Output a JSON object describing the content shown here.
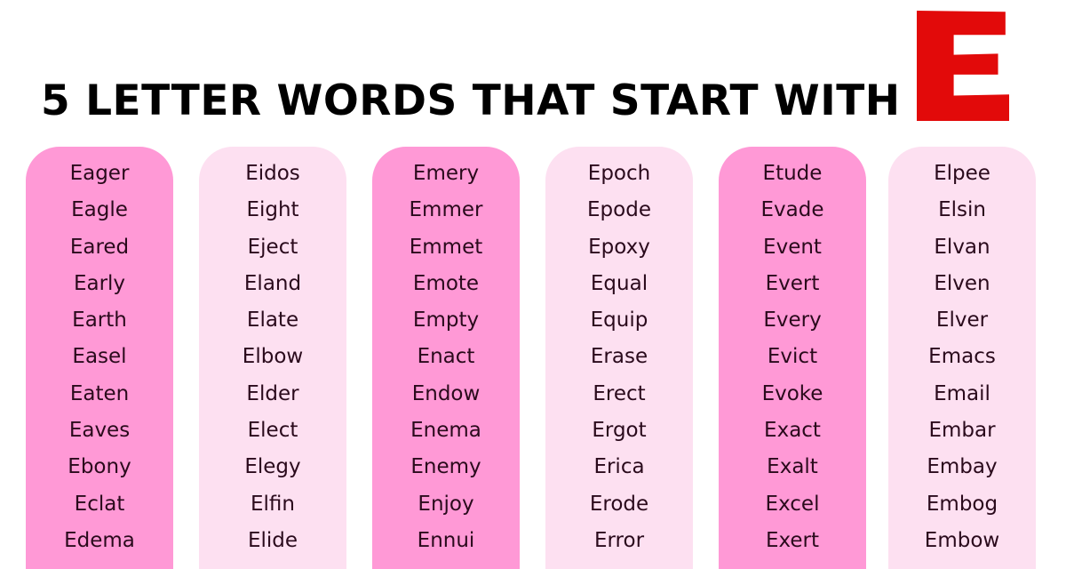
{
  "title": "5 LETTER WORDS THAT START WITH",
  "highlight_letter": "E",
  "colors": {
    "highlight_letter": "#e20a0a",
    "column_dark": "#ff99d6",
    "column_light": "#fde0f1",
    "text": "#2a0a1c"
  },
  "columns": [
    {
      "style": "dark",
      "words": [
        "Eager",
        "Eagle",
        "Eared",
        "Early",
        "Earth",
        "Easel",
        "Eaten",
        "Eaves",
        "Ebony",
        "Eclat",
        "Edema"
      ]
    },
    {
      "style": "light",
      "words": [
        "Eidos",
        "Eight",
        "Eject",
        "Eland",
        "Elate",
        "Elbow",
        "Elder",
        "Elect",
        "Elegy",
        "Elfin",
        "Elide"
      ]
    },
    {
      "style": "dark",
      "words": [
        "Emery",
        "Emmer",
        "Emmet",
        "Emote",
        "Empty",
        "Enact",
        "Endow",
        "Enema",
        "Enemy",
        "Enjoy",
        "Ennui"
      ]
    },
    {
      "style": "light",
      "words": [
        "Epoch",
        "Epode",
        "Epoxy",
        "Equal",
        "Equip",
        "Erase",
        "Erect",
        "Ergot",
        "Erica",
        "Erode",
        "Error"
      ]
    },
    {
      "style": "dark",
      "words": [
        "Etude",
        "Evade",
        "Event",
        "Evert",
        "Every",
        "Evict",
        "Evoke",
        "Exact",
        "Exalt",
        "Excel",
        "Exert"
      ]
    },
    {
      "style": "light",
      "words": [
        "Elpee",
        "Elsin",
        "Elvan",
        "Elven",
        "Elver",
        "Emacs",
        "Email",
        "Embar",
        "Embay",
        "Embog",
        "Embow"
      ]
    }
  ]
}
